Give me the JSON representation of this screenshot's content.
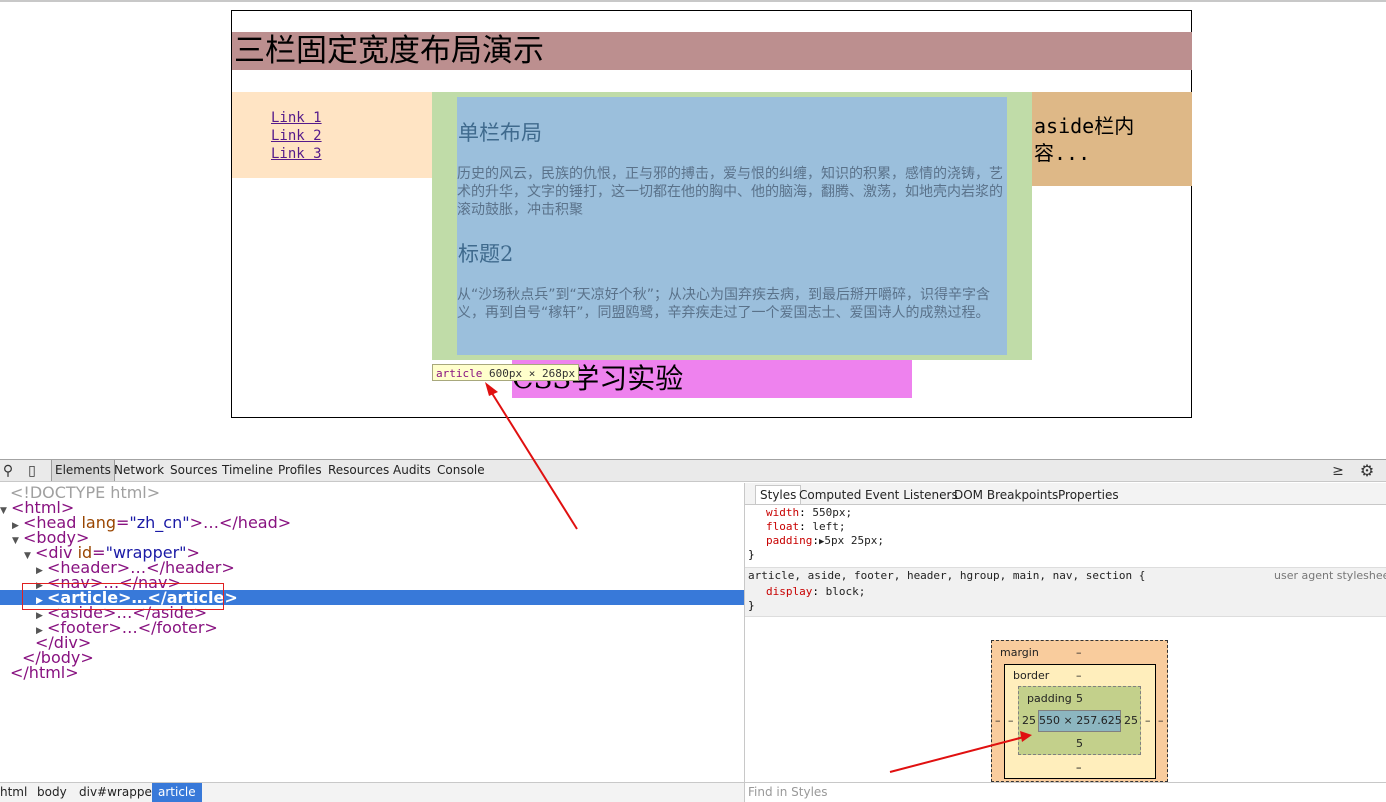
{
  "preview": {
    "header_title": "三栏固定宽度布局演示",
    "nav_links": [
      "Link 1",
      "Link 2",
      "Link 3"
    ],
    "article_h2_1": "单栏布局",
    "article_p_1": "历史的风云，民族的仇恨，正与邪的搏击，爱与恨的纠缠，知识的积累，感情的浇铸，艺术的升华，文字的锤打，这一切都在他的胸中、他的脑海，翻腾、激荡，如地壳内岩浆的滚动鼓胀，冲击积聚",
    "article_h2_2": "标题2",
    "article_p_2": "从“沙场秋点兵”到“天凉好个秋”；从决心为国弃疾去病，到最后掰开嚼碎，识得辛字含义，再到自号“稼轩”，同盟鸥鹭，辛弃疾走过了一个爱国志士、爱国诗人的成熟过程。",
    "aside_text": "aside栏内容...",
    "footer_title": "CSS学习实验",
    "tooltip_tag": "article",
    "tooltip_size": "600px × 268px"
  },
  "devtools": {
    "tabs": [
      "Elements",
      "Network",
      "Sources",
      "Timeline",
      "Profiles",
      "Resources",
      "Audits",
      "Console"
    ],
    "active_tab": "Elements",
    "tree": {
      "doctype": "<!DOCTYPE html>",
      "html_open": "<html>",
      "head": "<head lang=\"zh_cn\">…</head>",
      "head_tag": "<head ",
      "head_attr": "lang",
      "head_val": "\"zh_cn\"",
      "head_rest": ">…</head>",
      "body_open": "<body>",
      "div_tag": "<div ",
      "div_attr": "id",
      "div_val": "\"wrapper\"",
      "div_close_bracket": ">",
      "header": "<header>…</header>",
      "nav": "<nav>…</nav>",
      "article": "<article>…</article>",
      "aside": "<aside>…</aside>",
      "footer": "<footer>…</footer>",
      "div_close": "</div>",
      "body_close": "</body>",
      "html_close": "</html>"
    },
    "breadcrumbs": [
      "html",
      "body",
      "div#wrapper",
      "article"
    ],
    "styles_tabs": [
      "Styles",
      "Computed",
      "Event Listeners",
      "DOM Breakpoints",
      "Properties"
    ],
    "styles": {
      "rule1": [
        {
          "name": "width",
          "value": "550px;"
        },
        {
          "name": "float",
          "value": "left;"
        },
        {
          "name": "padding",
          "value": "5px 25px;"
        }
      ],
      "brace_close": "}",
      "ua_selector": "article, aside, footer, header, hgroup, main, nav, section {",
      "ua_source": "user agent stylesheet",
      "ua_prop_name": "display",
      "ua_prop_value": "block;"
    },
    "box_model": {
      "margin_label": "margin",
      "margin_top": "–",
      "margin_left": "–",
      "margin_right": "–",
      "margin_bottom": "–",
      "border_label": "border",
      "border_top": "–",
      "border_left": "–",
      "border_right": "–",
      "border_bottom": "–",
      "padding_label": "padding",
      "padding_top": "5",
      "padding_left": "25",
      "padding_right": "25",
      "padding_bottom": "5",
      "content": "550 × 257.625"
    },
    "find_placeholder": "Find in Styles"
  }
}
